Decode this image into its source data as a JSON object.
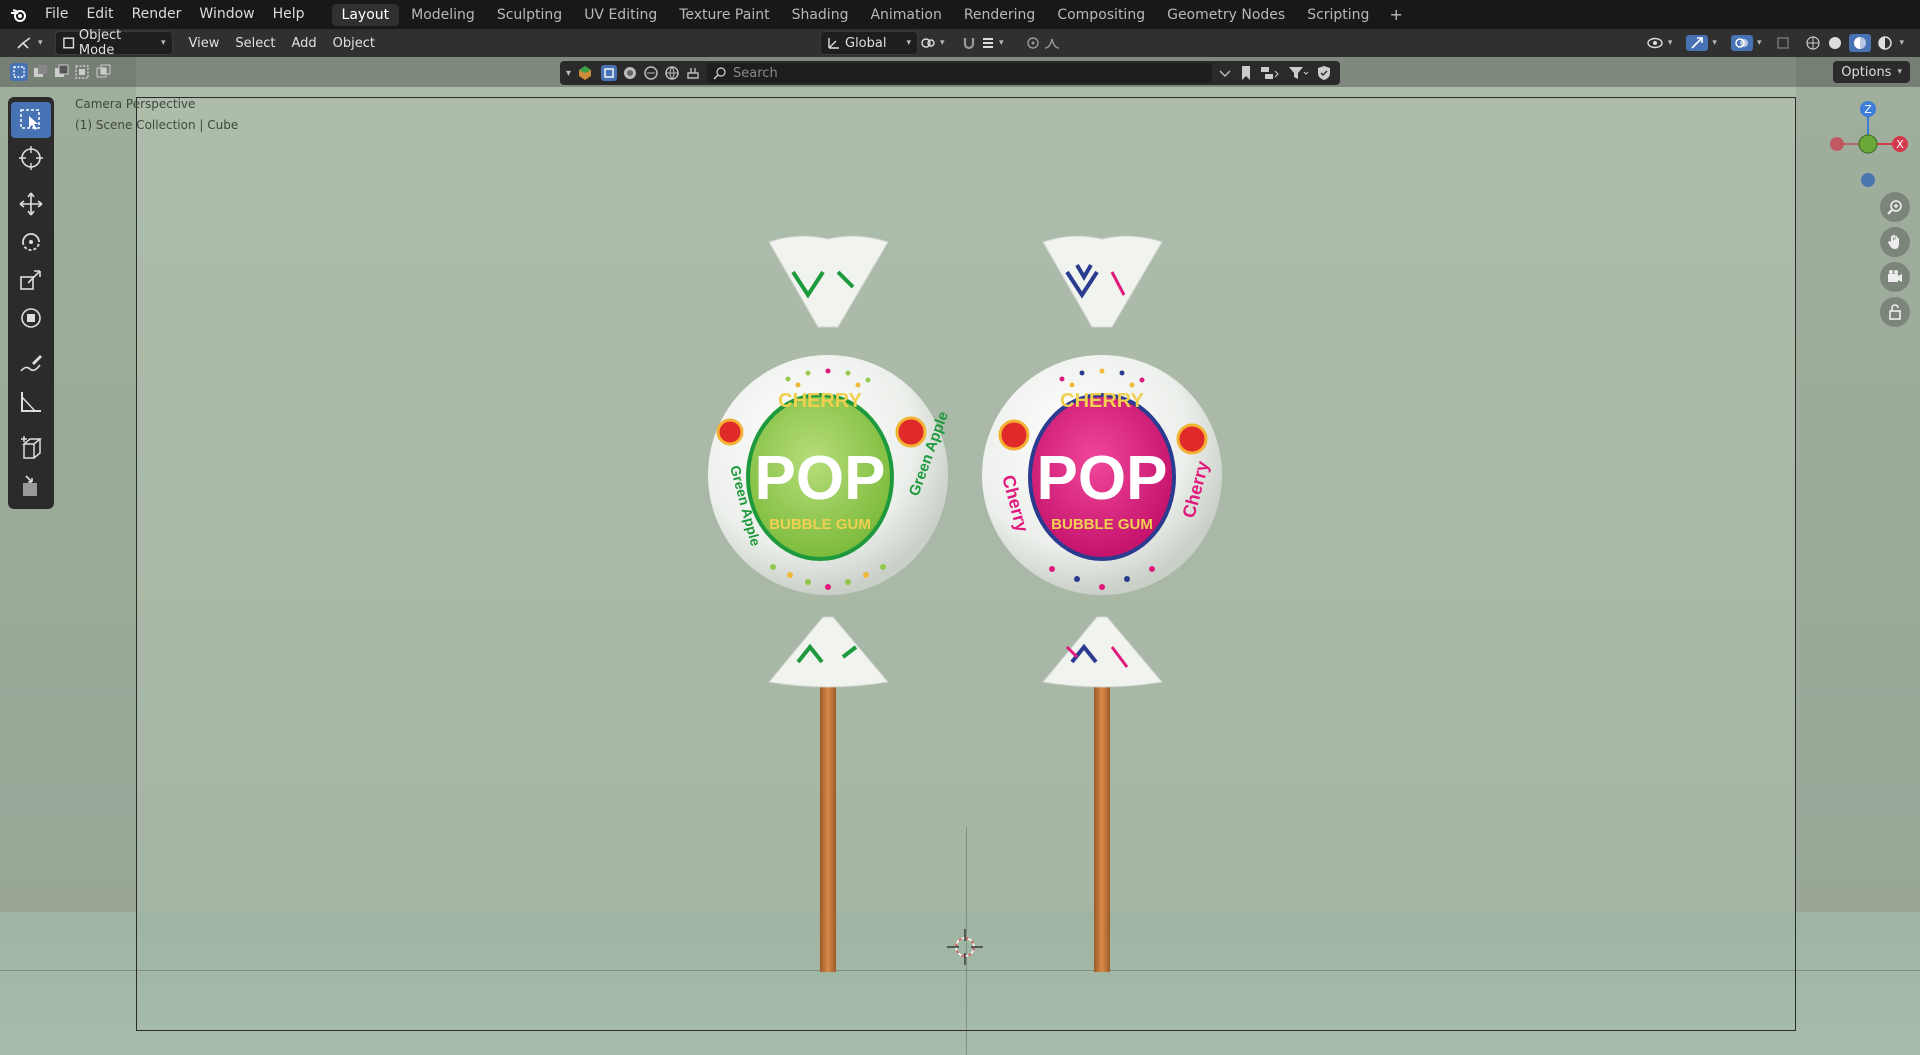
{
  "topbar": {
    "menus": [
      "File",
      "Edit",
      "Render",
      "Window",
      "Help"
    ],
    "workspaces": [
      "Layout",
      "Modeling",
      "Sculpting",
      "UV Editing",
      "Texture Paint",
      "Shading",
      "Animation",
      "Rendering",
      "Compositing",
      "Geometry Nodes",
      "Scripting"
    ],
    "active_workspace": "Layout",
    "add_tab": "+"
  },
  "header": {
    "mode": "Object Mode",
    "menus": [
      "View",
      "Select",
      "Add",
      "Object"
    ],
    "orientation": "Global"
  },
  "viewport": {
    "perspective_label": "Camera Perspective",
    "collection_label": "(1) Scene Collection | Cube",
    "search_placeholder": "Search",
    "options_label": "Options"
  },
  "gizmo": {
    "z": "Z",
    "x": "X"
  },
  "candies": [
    {
      "brand": "CHERRY",
      "title": "POP",
      "subtitle": "BUBBLE GUM",
      "flavor": "Green Apple",
      "color": "#8cc63f",
      "accent": "#1e9a3c"
    },
    {
      "brand": "CHERRY",
      "title": "POP",
      "subtitle": "BUBBLE GUM",
      "flavor": "Cherry",
      "color": "#e0197d",
      "accent": "#2b3b8f"
    }
  ],
  "colors": {
    "accent": "#4772b3",
    "x_axis": "#d33b4d",
    "y_axis": "#6aa73b",
    "z_axis": "#3b7dd8"
  }
}
